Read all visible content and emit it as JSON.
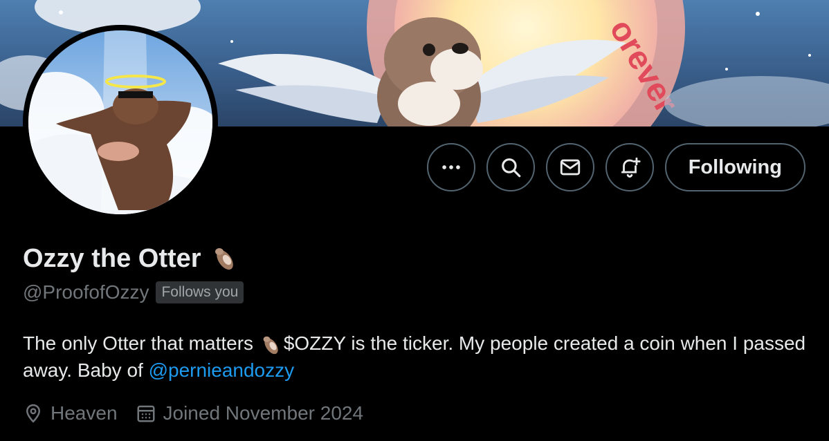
{
  "profile": {
    "name": "Ozzy the Otter",
    "handle": "@ProofofOzzy",
    "follows_you": "Follows you",
    "bio_part1": "The only Otter that matters",
    "bio_part2": "$OZZY is the ticker.  My people created a coin when I passed away. Baby of",
    "bio_mention": "@pernieandozzy",
    "location": "Heaven",
    "joined": "Joined November 2024"
  },
  "banner": {
    "text": "orever"
  },
  "actions": {
    "following_label": "Following",
    "icons": [
      "more-icon",
      "search-icon",
      "message-icon",
      "notification-bell-icon"
    ]
  },
  "colors": {
    "link": "#1d9bf0",
    "muted": "#71767b",
    "border": "#536471",
    "background": "#000000"
  }
}
